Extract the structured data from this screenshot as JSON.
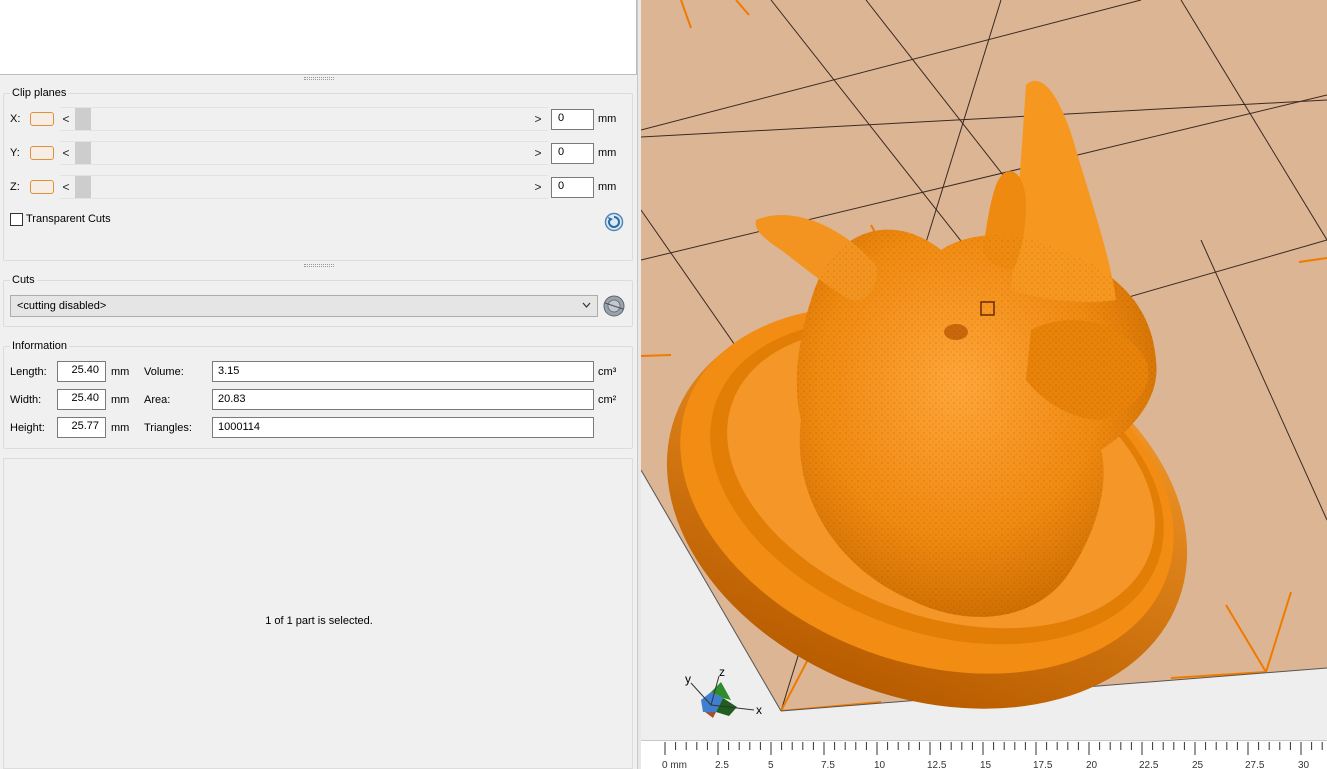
{
  "clip_planes": {
    "title": "Clip planes",
    "rows": [
      {
        "axis": "X:",
        "value": "0",
        "unit": "mm"
      },
      {
        "axis": "Y:",
        "value": "0",
        "unit": "mm"
      },
      {
        "axis": "Z:",
        "value": "0",
        "unit": "mm"
      }
    ],
    "left_arrow": "<",
    "right_arrow": ">",
    "transparent_cuts_label": "Transparent Cuts",
    "transparent_cuts_checked": false
  },
  "cuts": {
    "title": "Cuts",
    "selected": "<cutting disabled>"
  },
  "information": {
    "title": "Information",
    "length_label": "Length:",
    "length_value": "25.40",
    "length_unit": "mm",
    "width_label": "Width:",
    "width_value": "25.40",
    "width_unit": "mm",
    "height_label": "Height:",
    "height_value": "25.77",
    "height_unit": "mm",
    "volume_label": "Volume:",
    "volume_value": "3.15",
    "volume_unit": "cm³",
    "area_label": "Area:",
    "area_value": "20.83",
    "area_unit": "cm²",
    "triangles_label": "Triangles:",
    "triangles_value": "1000114"
  },
  "status": {
    "selection_text": "1 of 1 part is selected."
  },
  "viewport": {
    "axis_x": "x",
    "axis_y": "y",
    "axis_z": "z",
    "ruler_labels": [
      "0 mm",
      "2.5",
      "5",
      "7.5",
      "10",
      "12.5",
      "15",
      "17.5",
      "20",
      "22.5",
      "25",
      "27.5",
      "30"
    ],
    "model_color": "#f28c12",
    "bed_color": "#d9b28f"
  }
}
